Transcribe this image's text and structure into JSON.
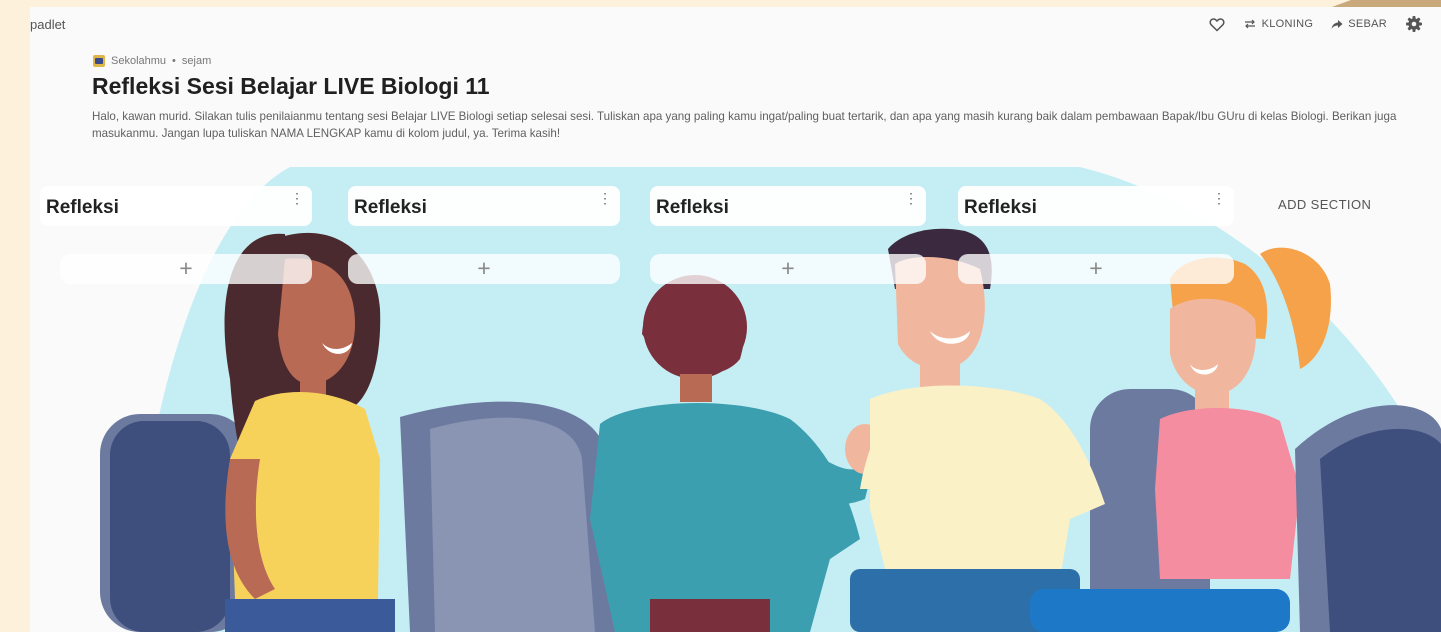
{
  "app": {
    "brand": "padlet"
  },
  "toolbar": {
    "like_icon": "heart-icon",
    "clone_label": "KLONING",
    "share_label": "SEBAR",
    "settings_icon": "gear-icon"
  },
  "breadcrumb": {
    "author": "Sekolahmu",
    "separator": "•",
    "time": "sejam"
  },
  "board": {
    "title": "Refleksi Sesi Belajar LIVE Biologi 11",
    "description": "Halo, kawan murid. Silakan tulis penilaianmu tentang sesi Belajar LIVE Biologi setiap selesai sesi. Tuliskan apa yang paling kamu ingat/paling buat tertarik, dan apa yang masih kurang baik dalam pembawaan Bapak/Ibu GUru di kelas Biologi. Berikan juga masukanmu. Jangan lupa tuliskan NAMA LENGKAP kamu di kolom judul, ya. Terima kasih!",
    "sections": [
      {
        "title": "Refleksi",
        "menu": "⋮",
        "add": "+"
      },
      {
        "title": "Refleksi",
        "menu": "⋮",
        "add": "+"
      },
      {
        "title": "Refleksi",
        "menu": "⋮",
        "add": "+"
      },
      {
        "title": "Refleksi",
        "menu": "⋮",
        "add": "+"
      }
    ],
    "add_section_label": "ADD SECTION"
  },
  "colors": {
    "page_background": "#fdf1dc",
    "board_background": "#fafafa",
    "illustration_sky": "#c5eef4",
    "chair": "#6d7aa0",
    "shirt_yellow": "#f7d25b",
    "shirt_teal": "#3c9fb0",
    "shirt_cream": "#faf1c7",
    "shirt_pink": "#f58da0",
    "hair_orange": "#f6a24a"
  }
}
